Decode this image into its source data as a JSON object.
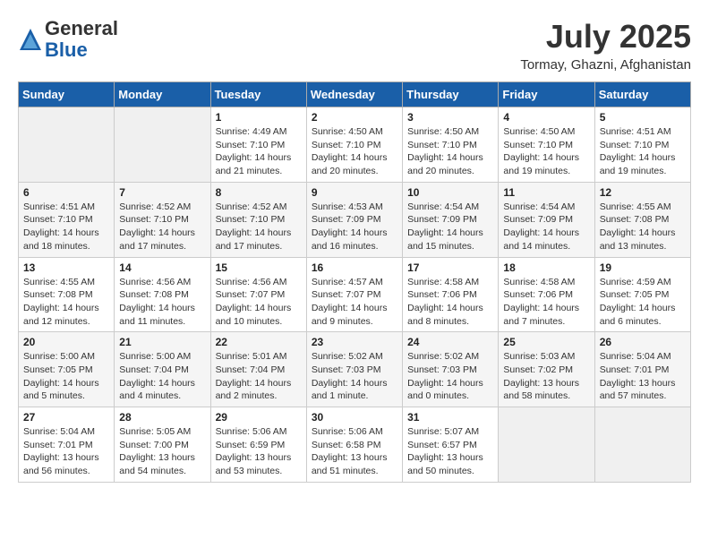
{
  "header": {
    "logo_line1": "General",
    "logo_line2": "Blue",
    "month_year": "July 2025",
    "location": "Tormay, Ghazni, Afghanistan"
  },
  "days_of_week": [
    "Sunday",
    "Monday",
    "Tuesday",
    "Wednesday",
    "Thursday",
    "Friday",
    "Saturday"
  ],
  "weeks": [
    [
      {
        "day": "",
        "info": ""
      },
      {
        "day": "",
        "info": ""
      },
      {
        "day": "1",
        "info": "Sunrise: 4:49 AM\nSunset: 7:10 PM\nDaylight: 14 hours and 21 minutes."
      },
      {
        "day": "2",
        "info": "Sunrise: 4:50 AM\nSunset: 7:10 PM\nDaylight: 14 hours and 20 minutes."
      },
      {
        "day": "3",
        "info": "Sunrise: 4:50 AM\nSunset: 7:10 PM\nDaylight: 14 hours and 20 minutes."
      },
      {
        "day": "4",
        "info": "Sunrise: 4:50 AM\nSunset: 7:10 PM\nDaylight: 14 hours and 19 minutes."
      },
      {
        "day": "5",
        "info": "Sunrise: 4:51 AM\nSunset: 7:10 PM\nDaylight: 14 hours and 19 minutes."
      }
    ],
    [
      {
        "day": "6",
        "info": "Sunrise: 4:51 AM\nSunset: 7:10 PM\nDaylight: 14 hours and 18 minutes."
      },
      {
        "day": "7",
        "info": "Sunrise: 4:52 AM\nSunset: 7:10 PM\nDaylight: 14 hours and 17 minutes."
      },
      {
        "day": "8",
        "info": "Sunrise: 4:52 AM\nSunset: 7:10 PM\nDaylight: 14 hours and 17 minutes."
      },
      {
        "day": "9",
        "info": "Sunrise: 4:53 AM\nSunset: 7:09 PM\nDaylight: 14 hours and 16 minutes."
      },
      {
        "day": "10",
        "info": "Sunrise: 4:54 AM\nSunset: 7:09 PM\nDaylight: 14 hours and 15 minutes."
      },
      {
        "day": "11",
        "info": "Sunrise: 4:54 AM\nSunset: 7:09 PM\nDaylight: 14 hours and 14 minutes."
      },
      {
        "day": "12",
        "info": "Sunrise: 4:55 AM\nSunset: 7:08 PM\nDaylight: 14 hours and 13 minutes."
      }
    ],
    [
      {
        "day": "13",
        "info": "Sunrise: 4:55 AM\nSunset: 7:08 PM\nDaylight: 14 hours and 12 minutes."
      },
      {
        "day": "14",
        "info": "Sunrise: 4:56 AM\nSunset: 7:08 PM\nDaylight: 14 hours and 11 minutes."
      },
      {
        "day": "15",
        "info": "Sunrise: 4:56 AM\nSunset: 7:07 PM\nDaylight: 14 hours and 10 minutes."
      },
      {
        "day": "16",
        "info": "Sunrise: 4:57 AM\nSunset: 7:07 PM\nDaylight: 14 hours and 9 minutes."
      },
      {
        "day": "17",
        "info": "Sunrise: 4:58 AM\nSunset: 7:06 PM\nDaylight: 14 hours and 8 minutes."
      },
      {
        "day": "18",
        "info": "Sunrise: 4:58 AM\nSunset: 7:06 PM\nDaylight: 14 hours and 7 minutes."
      },
      {
        "day": "19",
        "info": "Sunrise: 4:59 AM\nSunset: 7:05 PM\nDaylight: 14 hours and 6 minutes."
      }
    ],
    [
      {
        "day": "20",
        "info": "Sunrise: 5:00 AM\nSunset: 7:05 PM\nDaylight: 14 hours and 5 minutes."
      },
      {
        "day": "21",
        "info": "Sunrise: 5:00 AM\nSunset: 7:04 PM\nDaylight: 14 hours and 4 minutes."
      },
      {
        "day": "22",
        "info": "Sunrise: 5:01 AM\nSunset: 7:04 PM\nDaylight: 14 hours and 2 minutes."
      },
      {
        "day": "23",
        "info": "Sunrise: 5:02 AM\nSunset: 7:03 PM\nDaylight: 14 hours and 1 minute."
      },
      {
        "day": "24",
        "info": "Sunrise: 5:02 AM\nSunset: 7:03 PM\nDaylight: 14 hours and 0 minutes."
      },
      {
        "day": "25",
        "info": "Sunrise: 5:03 AM\nSunset: 7:02 PM\nDaylight: 13 hours and 58 minutes."
      },
      {
        "day": "26",
        "info": "Sunrise: 5:04 AM\nSunset: 7:01 PM\nDaylight: 13 hours and 57 minutes."
      }
    ],
    [
      {
        "day": "27",
        "info": "Sunrise: 5:04 AM\nSunset: 7:01 PM\nDaylight: 13 hours and 56 minutes."
      },
      {
        "day": "28",
        "info": "Sunrise: 5:05 AM\nSunset: 7:00 PM\nDaylight: 13 hours and 54 minutes."
      },
      {
        "day": "29",
        "info": "Sunrise: 5:06 AM\nSunset: 6:59 PM\nDaylight: 13 hours and 53 minutes."
      },
      {
        "day": "30",
        "info": "Sunrise: 5:06 AM\nSunset: 6:58 PM\nDaylight: 13 hours and 51 minutes."
      },
      {
        "day": "31",
        "info": "Sunrise: 5:07 AM\nSunset: 6:57 PM\nDaylight: 13 hours and 50 minutes."
      },
      {
        "day": "",
        "info": ""
      },
      {
        "day": "",
        "info": ""
      }
    ]
  ]
}
